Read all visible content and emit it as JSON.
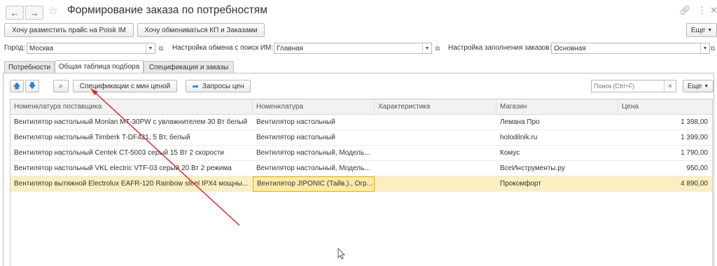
{
  "window": {
    "title": "Формирование заказа по потребностям"
  },
  "toolbar": {
    "poisk_button": "Хочу разместить прайс на Poisk IM",
    "exchange_button": "Хочу обмениваться КП и Заказами",
    "more_button": "Еще"
  },
  "filters": {
    "city_label": "Город:",
    "city_value": "Москва",
    "exchange_label": "Настройка обмена с поиск ИМ:",
    "exchange_value": "Главная",
    "fill_label": "Настройка заполнения заказов:",
    "fill_value": "Основная"
  },
  "tabs": [
    {
      "label": "Потребности"
    },
    {
      "label": "Общая таблица подбора"
    },
    {
      "label": "Спецификация и заказы"
    }
  ],
  "panel_toolbar": {
    "spec_button": "Спецификации с мин ценой",
    "prices_button": "Запросы цен",
    "search_placeholder": "Поиск (Ctrl+F)",
    "more_button": "Еще"
  },
  "table": {
    "columns": [
      "Номенклатура поставщика",
      "Номенклатура",
      "Характеристика",
      "Магазин",
      "Цена"
    ],
    "rows": [
      {
        "supplier_item": "Вентилятор настольный Monlan MT-30PW с увлажнителем 30 Вт белый",
        "item": "Вентилятор настольный",
        "characteristic": "",
        "shop": "Лемана Про",
        "price": "1 398,00"
      },
      {
        "supplier_item": "Вентилятор настольный Timberk T-DF421, 5 Вт, белый",
        "item": "Вентилятор настольный",
        "characteristic": "",
        "shop": "holodilnik.ru",
        "price": "1 399,00"
      },
      {
        "supplier_item": "Вентилятор настольный Centek CT-5003 серый 15 Вт 2 скорости",
        "item": "Вентилятор настольный, Модель...",
        "characteristic": "",
        "shop": "Комус",
        "price": "1 790,00"
      },
      {
        "supplier_item": "Вентилятор настольный VKL electric VTF-03 серый 20 Вт 2 режима",
        "item": "Вентилятор настольный, Модель...",
        "characteristic": "",
        "shop": "ВсеИнструменты.ру",
        "price": "950,00"
      },
      {
        "supplier_item": "Вентилятор вытяжной Electrolux EAFR-120 Rainbow steel IPX4 мощны...",
        "item": "Вентилятор JIPONIC (Тайв.)., Огр...",
        "characteristic": "",
        "shop": "Прокомфорт",
        "price": "4 890,00"
      }
    ]
  },
  "colors": {
    "selected_row": "#fbeec0",
    "annotation_arrow": "#e02020",
    "nav_arrows": "#2f7fd0"
  }
}
